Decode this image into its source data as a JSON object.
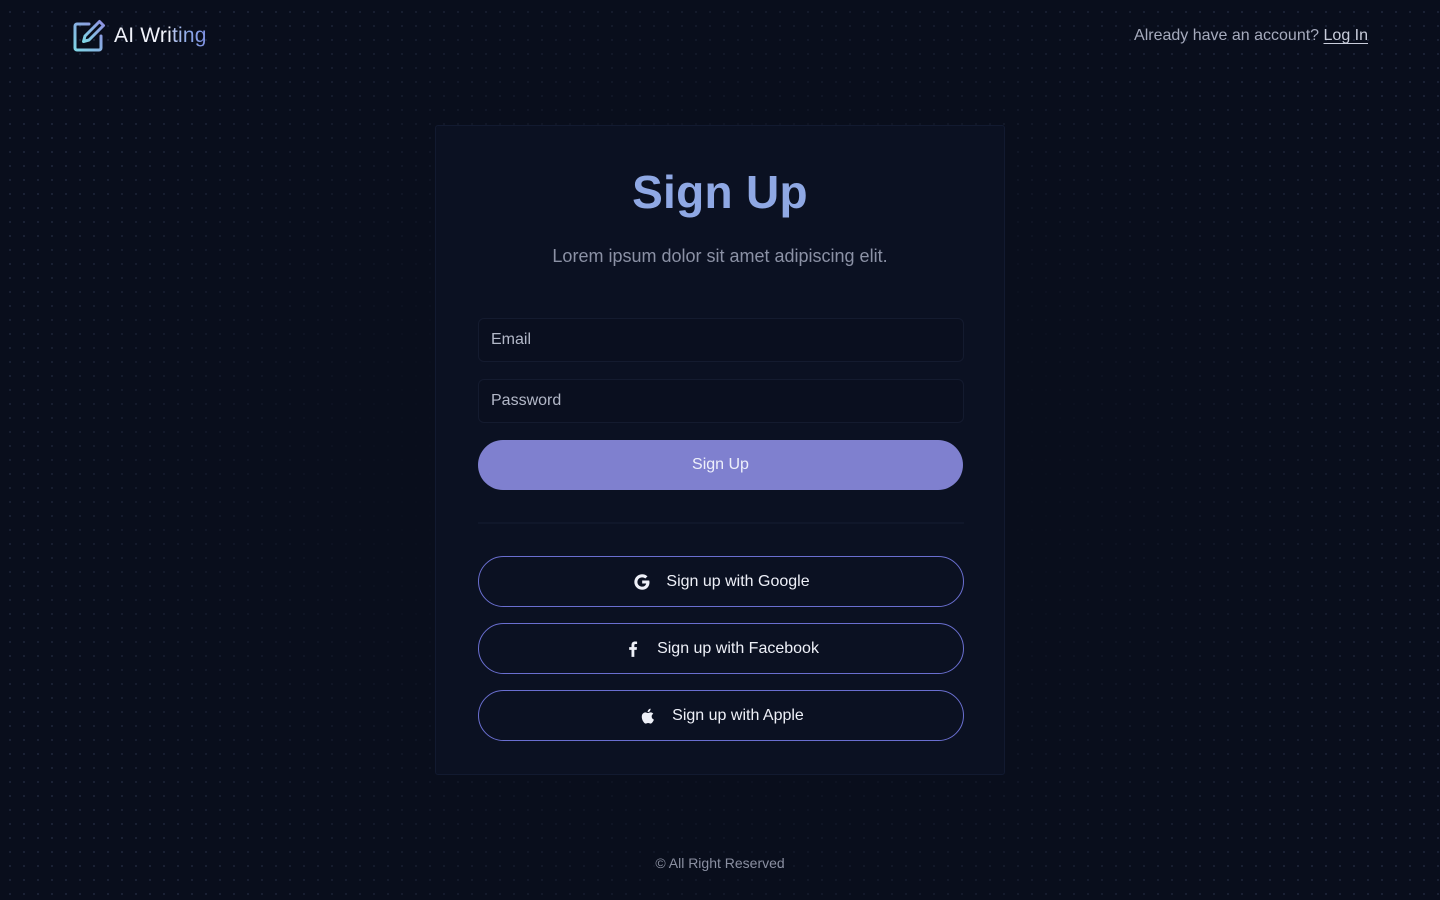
{
  "header": {
    "logo": {
      "icon": "pencil-square-icon",
      "text_part1": "AI Wri",
      "text_part2": "ting"
    },
    "account_prompt": "Already have an account?",
    "login_link": "Log In"
  },
  "form": {
    "title": "Sign Up",
    "subtitle": "Lorem ipsum dolor sit amet adipiscing elit.",
    "email": {
      "value": "",
      "placeholder": "Email"
    },
    "password": {
      "value": "",
      "placeholder": "Password"
    },
    "submit_label": "Sign Up"
  },
  "social": [
    {
      "icon": "google-icon",
      "label": "Sign up with Google"
    },
    {
      "icon": "facebook-icon",
      "label": "Sign up with Facebook"
    },
    {
      "icon": "apple-icon",
      "label": "Sign up with Apple"
    }
  ],
  "footer": {
    "copyright": "© All Right Reserved"
  },
  "colors": {
    "background": "#090e1c",
    "card": "#0b1122",
    "accent": "#7f80cf",
    "title": "#8fa8e4",
    "social_border": "#6a6fd0"
  }
}
